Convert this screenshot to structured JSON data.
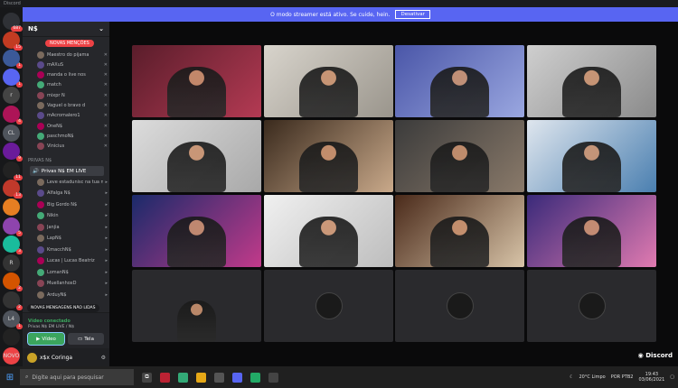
{
  "window_title": "Discord",
  "streamer_notice": {
    "text": "O modo streamer está ativo. Se cuide, hein.",
    "button": "Desativar"
  },
  "guilds": [
    {
      "label": "",
      "badge": "687"
    },
    {
      "label": "",
      "badge": "15"
    },
    {
      "label": "",
      "badge": "1"
    },
    {
      "label": "",
      "badge": "1"
    },
    {
      "label": "r",
      "badge": ""
    },
    {
      "label": "",
      "badge": "4"
    },
    {
      "label": "CL",
      "badge": ""
    },
    {
      "label": "",
      "badge": "9"
    },
    {
      "label": "",
      "badge": "11"
    },
    {
      "label": "",
      "badge": "13"
    },
    {
      "label": "",
      "badge": ""
    },
    {
      "label": "",
      "badge": "5"
    },
    {
      "label": "",
      "badge": "3"
    },
    {
      "label": "R",
      "badge": ""
    },
    {
      "label": "",
      "badge": "2"
    },
    {
      "label": "",
      "badge": "2"
    },
    {
      "label": "L4",
      "badge": "1"
    },
    {
      "label": "",
      "badge": ""
    },
    {
      "label": "NOVO",
      "badge": ""
    }
  ],
  "server_name": "N$",
  "new_mentions": "NOVAS MENÇÕES",
  "top_users": [
    "Maestro do pijama",
    "mAXuS",
    "manda o live nos",
    "match",
    "mixpr N",
    "Vaguel o bravo d",
    "mAcromalero1",
    "OneN$",
    "paschmoN$",
    "Vinicius"
  ],
  "category": "PRIVAS N$",
  "voice_channel": "Privas N$ EM LIVE",
  "voice_users": [
    "Leve estadunisc na tua nalo",
    "Alfalga N$",
    "Big Gordo N$",
    "Nikin",
    "Janjia",
    "LapN$",
    "KmacchN$",
    "Lucas | Lucas Beatriz",
    "LomanN$",
    "MuellanhoxD",
    "ArduyN$"
  ],
  "new_unread": "NOVAS MENSAGENS NÃO LIDAS",
  "voice_panel": {
    "status": "Vídeo conectado",
    "channel": "Privas N$ EM LIVE / N$",
    "video_btn": "Vídeo",
    "screen_btn": "Tela"
  },
  "current_user": "x$x Coringa",
  "brand": "Discord",
  "taskbar": {
    "search_placeholder": "Digite aqui para pesquisar",
    "weather": "20°C Limpo",
    "lang": "POR PTB2",
    "time": "19:43",
    "date": "03/06/2021"
  },
  "colors": {
    "blurple": "#5865f2",
    "online": "#3ba55d",
    "danger": "#ed4245"
  }
}
